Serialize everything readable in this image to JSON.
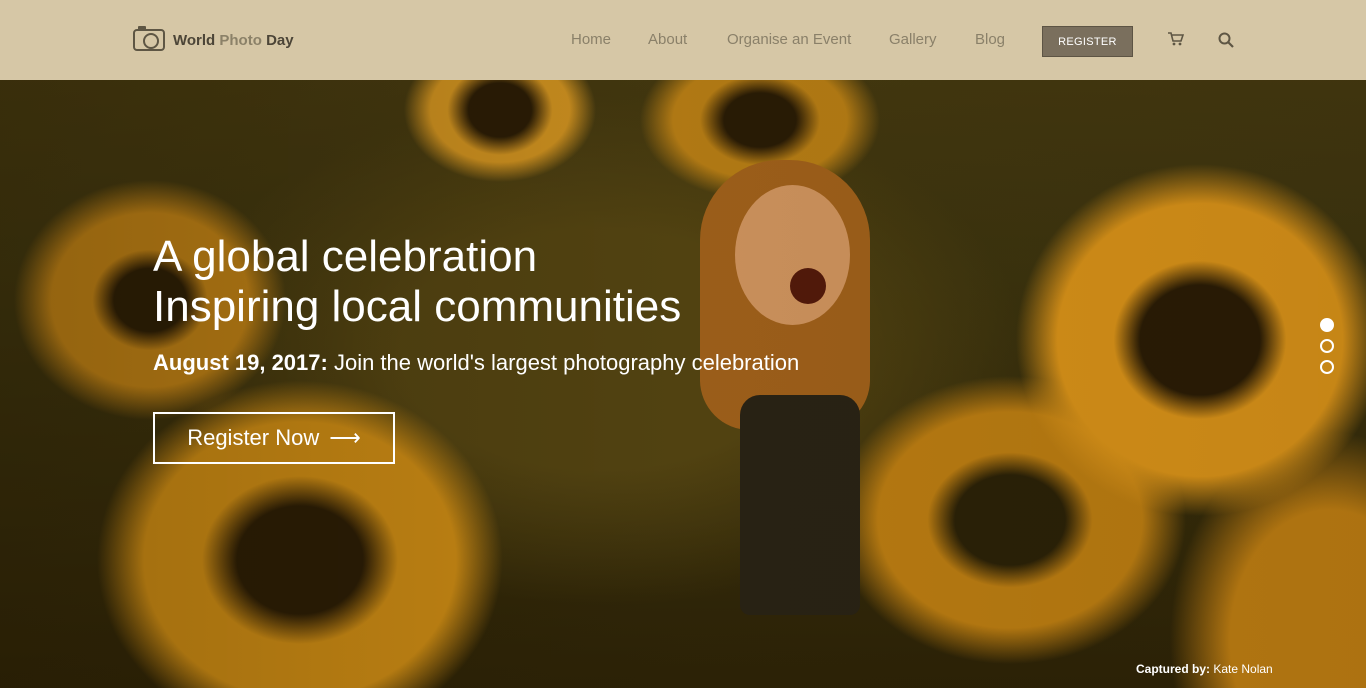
{
  "brand": {
    "name_bold": "World",
    "name_light": "Photo",
    "name_end": "Day",
    "logo_icon": "camera-icon"
  },
  "nav": {
    "items": [
      "Home",
      "About",
      "Organise an Event",
      "Gallery",
      "Blog"
    ],
    "register_label": "REGISTER",
    "cart_icon": "cart-icon",
    "search_icon": "search-icon"
  },
  "hero": {
    "headline_line1": "A global celebration",
    "headline_line2": "Inspiring local communities",
    "date": "August 19, 2017:",
    "tagline": " Join the world's largest photography celebration",
    "cta_label": "Register Now",
    "cta_icon": "arrow-right-icon",
    "slides": {
      "count": 3,
      "active": 1
    }
  },
  "credit": {
    "label": "Captured by:",
    "name": "Kate Nolan"
  },
  "colors": {
    "header_bg": "#d6c7a6",
    "register_bg": "#7a6f5d",
    "hero_text": "#ffffff",
    "accent_sunflower": "#e29a17"
  }
}
